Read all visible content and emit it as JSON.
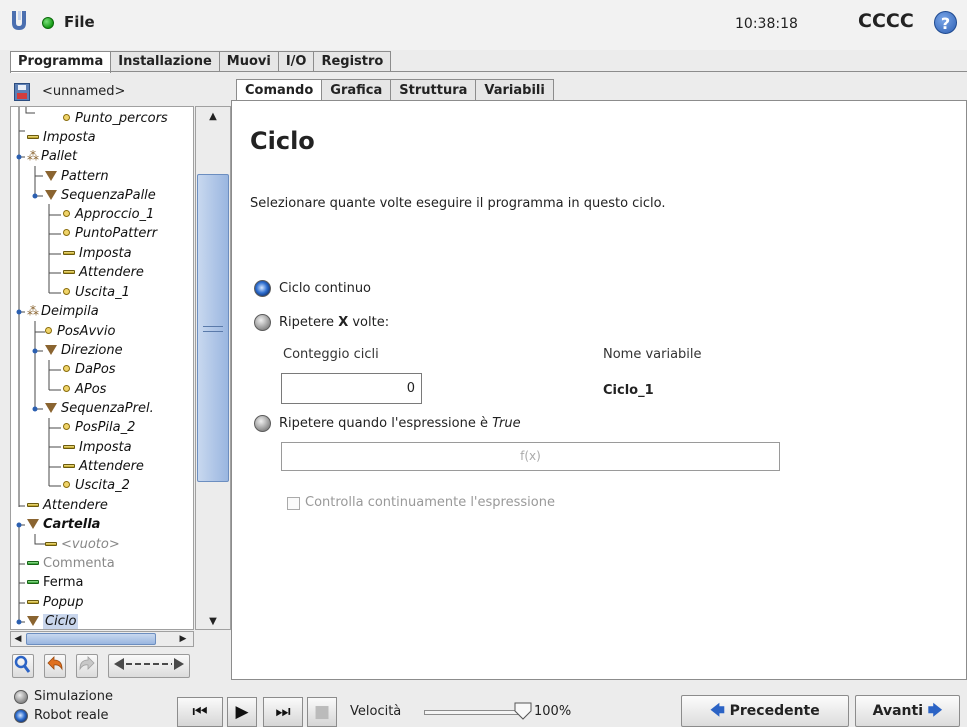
{
  "header": {
    "file_label": "File",
    "time": "10:38:18",
    "robot_name": "CCCC",
    "help_label": "?"
  },
  "main_tabs": [
    {
      "label": "Programma",
      "active": true
    },
    {
      "label": "Installazione",
      "active": false
    },
    {
      "label": "Muovi",
      "active": false
    },
    {
      "label": "I/O",
      "active": false
    },
    {
      "label": "Registro",
      "active": false
    }
  ],
  "program": {
    "name": "<unnamed>"
  },
  "tree": [
    {
      "label": "Punto_percors",
      "icon": "waypoint-icon"
    },
    {
      "label": "Imposta",
      "icon": "set-icon"
    },
    {
      "label": "Pallet",
      "icon": "pallet-icon"
    },
    {
      "label": "Pattern",
      "icon": "folder-icon"
    },
    {
      "label": "SequenzaPalle",
      "icon": "folder-icon"
    },
    {
      "label": "Approccio_1",
      "icon": "waypoint-icon"
    },
    {
      "label": "PuntoPatterr",
      "icon": "waypoint-icon"
    },
    {
      "label": "Imposta",
      "icon": "set-icon"
    },
    {
      "label": "Attendere",
      "icon": "wait-icon"
    },
    {
      "label": "Uscita_1",
      "icon": "waypoint-icon"
    },
    {
      "label": "Deimpila",
      "icon": "pallet-icon"
    },
    {
      "label": "PosAvvio",
      "icon": "waypoint-icon"
    },
    {
      "label": "Direzione",
      "icon": "folder-icon"
    },
    {
      "label": "DaPos",
      "icon": "waypoint-icon"
    },
    {
      "label": "APos",
      "icon": "waypoint-icon"
    },
    {
      "label": "SequenzaPrel.",
      "icon": "folder-icon"
    },
    {
      "label": "PosPila_2",
      "icon": "waypoint-icon"
    },
    {
      "label": "Imposta",
      "icon": "set-icon"
    },
    {
      "label": "Attendere",
      "icon": "wait-icon"
    },
    {
      "label": "Uscita_2",
      "icon": "waypoint-icon"
    },
    {
      "label": "Attendere",
      "icon": "wait-icon"
    },
    {
      "label": "Cartella",
      "icon": "folder-icon"
    },
    {
      "label": "<vuoto>",
      "icon": "empty-icon"
    },
    {
      "label": "Commenta",
      "icon": "comment-icon"
    },
    {
      "label": "Ferma",
      "icon": "halt-icon"
    },
    {
      "label": "Popup",
      "icon": "popup-icon"
    },
    {
      "label": "Ciclo",
      "icon": "loop-icon"
    }
  ],
  "sub_tabs": [
    {
      "label": "Comando",
      "active": true
    },
    {
      "label": "Grafica",
      "active": false
    },
    {
      "label": "Struttura",
      "active": false
    },
    {
      "label": "Variabili",
      "active": false
    }
  ],
  "command": {
    "title": "Ciclo",
    "description": "Selezionare quante volte eseguire il programma in questo ciclo.",
    "opt_continuous": "Ciclo continuo",
    "opt_repeat_prefix": "Ripetere ",
    "opt_repeat_x": "X",
    "opt_repeat_suffix": " volte:",
    "count_label": "Conteggio cicli",
    "count_value": "0",
    "var_label": "Nome variabile",
    "var_value": "Ciclo_1",
    "opt_expr_prefix": "Ripetere quando l'espressione è ",
    "opt_expr_true": "True",
    "expr_placeholder": "f(x)",
    "check_label": "Controlla continuamente l'espressione",
    "selected_option": "Ciclo continuo"
  },
  "footer": {
    "sim_label": "Simulazione",
    "real_label": "Robot reale",
    "speed_label": "Velocità",
    "speed_value": "100%",
    "speed_fraction": 1.0,
    "prev_label": "Precedente",
    "next_label": "Avanti"
  },
  "colors": {
    "accent": "#2f6fd0",
    "status_green": "#159a15",
    "tree_folder": "#8a6430"
  }
}
